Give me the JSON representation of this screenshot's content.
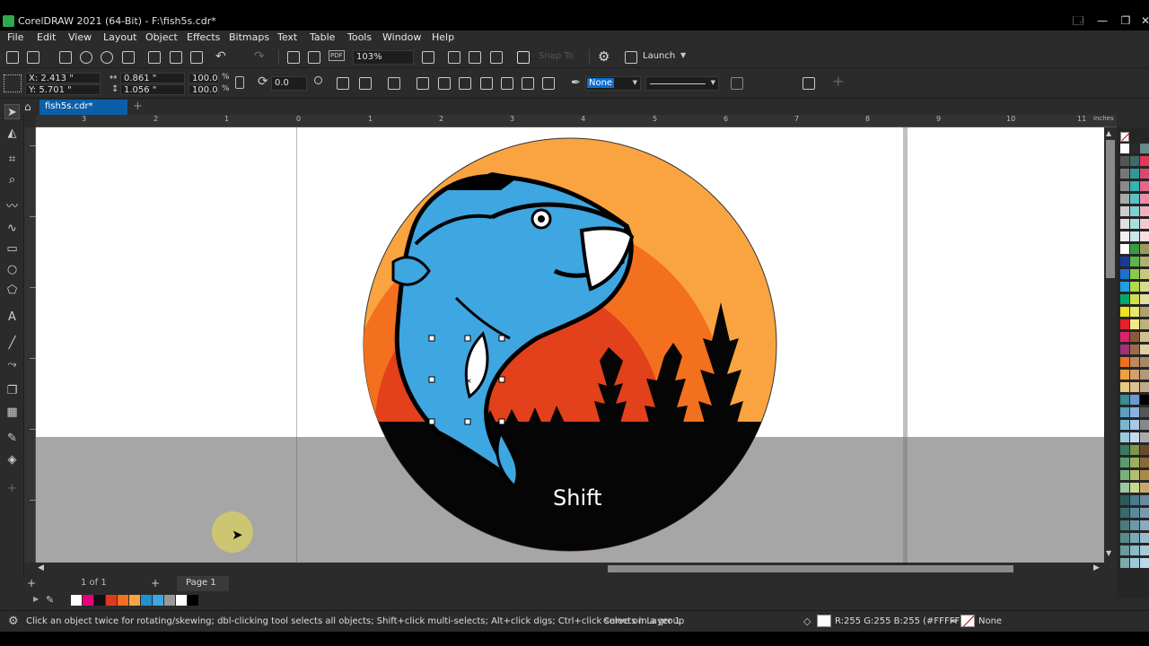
{
  "window": {
    "title": "CorelDRAW 2021 (64-Bit) - F:\\fish5s.cdr*",
    "controls": [
      "🗔",
      "—",
      "❐",
      "✕"
    ]
  },
  "menu": [
    "File",
    "Edit",
    "View",
    "Layout",
    "Object",
    "Effects",
    "Bitmaps",
    "Text",
    "Table",
    "Tools",
    "Window",
    "Help"
  ],
  "toolbar": {
    "zoom": "103%",
    "snap_label": "Snap To",
    "launch_label": "Launch"
  },
  "property_bar": {
    "x": "X: 2.413 \"",
    "y": "Y: 5.701 \"",
    "width": "0.861 \"",
    "height": "1.056 \"",
    "scale_x": "100.0",
    "scale_y": "100.0",
    "percent": "%",
    "rotation": "0.0",
    "fill_value": "None"
  },
  "document": {
    "tab_label": "fish5s.cdr*",
    "canvas_overlay_text": "Shift"
  },
  "ruler": {
    "h_labels": [
      "3",
      "2",
      "1",
      "0",
      "1",
      "2",
      "3",
      "4",
      "5",
      "6",
      "7",
      "8",
      "9",
      "10",
      "11"
    ],
    "unit": "inches"
  },
  "page_nav": {
    "counter": "1 of 1",
    "page_tab": "Page 1"
  },
  "status": {
    "hint": "Click an object twice for rotating/skewing; dbl-clicking tool selects all objects; Shift+click multi-selects; Alt+click digs; Ctrl+click selects in a group",
    "object_info": "Curve on Layer 1",
    "fill_info": "R:255 G:255 B:255 (#FFFFFF)",
    "outline_info": "None"
  },
  "colors": {
    "sun_light": "#f9a441",
    "sun_mid": "#f2701e",
    "sun_dark": "#e3401c",
    "fish_blue": "#3ea6e0",
    "selection_blue": "#0b5fa8"
  },
  "doc_palette_colors": [
    "#ffffff",
    "#e6007e",
    "#111111",
    "#e03a1c",
    "#f2701e",
    "#f9a441",
    "#1f93d1",
    "#3ea6e0",
    "#999999",
    "#ffffff",
    "#000000"
  ],
  "palette_colors": [
    [
      "#ffffff",
      "#2a2a2a",
      "#6a8a8a"
    ],
    [
      "#555555",
      "#3b6b6b",
      "#e03a5a"
    ],
    [
      "#777777",
      "#2e9a9a",
      "#d84a70"
    ],
    [
      "#8a8a8a",
      "#3ab0b0",
      "#e06a8a"
    ],
    [
      "#aaaaaa",
      "#58c2c2",
      "#e890a8"
    ],
    [
      "#cccccc",
      "#7fd0d0",
      "#f0b0c0"
    ],
    [
      "#e0e0e0",
      "#a8dede",
      "#f5c8d0"
    ],
    [
      "#f0f0f0",
      "#c8e8e8",
      "#f8dde2"
    ],
    [
      "#ffffff",
      "#3a9a40",
      "#9a9a60"
    ],
    [
      "#1a3a9a",
      "#5ab84a",
      "#b0b070"
    ],
    [
      "#1f6fd0",
      "#8ac84a",
      "#c8c880"
    ],
    [
      "#20a0e0",
      "#b0d84a",
      "#d8d890"
    ],
    [
      "#00a870",
      "#d0e04a",
      "#e0e0a0"
    ],
    [
      "#f0e020",
      "#e8e86a",
      "#b0a070"
    ],
    [
      "#e8202a",
      "#f0e88a",
      "#c0b080"
    ],
    [
      "#e0206a",
      "#8a5a3a",
      "#d0c090"
    ],
    [
      "#a0307a",
      "#a06a4a",
      "#e0d0a0"
    ],
    [
      "#f07020",
      "#c08a5a",
      "#a08a6a"
    ],
    [
      "#f0a040",
      "#d0a070",
      "#b09a7a"
    ],
    [
      "#e8c880",
      "#e0c090",
      "#c0aa8a"
    ],
    [
      "#3a8a90",
      "#6a9ad0",
      "#000000"
    ],
    [
      "#5aa0c0",
      "#8ab0e0",
      "#555555"
    ],
    [
      "#7ab8d0",
      "#a8c8ea",
      "#888888"
    ],
    [
      "#9acadc",
      "#c8dcf0",
      "#aaaaaa"
    ],
    [
      "#3a7a60",
      "#7a9a4a",
      "#6a4a2a"
    ],
    [
      "#5a9a70",
      "#9ab060",
      "#8a6a3a"
    ],
    [
      "#7ab080",
      "#b0c070",
      "#aa8a4a"
    ],
    [
      "#9ac8a0",
      "#c8d890",
      "#c8a86a"
    ],
    [
      "#2a5a5a",
      "#4a7a8a",
      "#6a8aa0"
    ],
    [
      "#3a6a6a",
      "#5a8a9a",
      "#7a9ab0"
    ],
    [
      "#4a7a7a",
      "#6a9aaa",
      "#8aaabe"
    ],
    [
      "#5a8a8a",
      "#7aaaba",
      "#9abacc"
    ],
    [
      "#6a9a9a",
      "#8abaca",
      "#aacada"
    ],
    [
      "#7aaaaa",
      "#9acada",
      "#bad8e6"
    ]
  ]
}
